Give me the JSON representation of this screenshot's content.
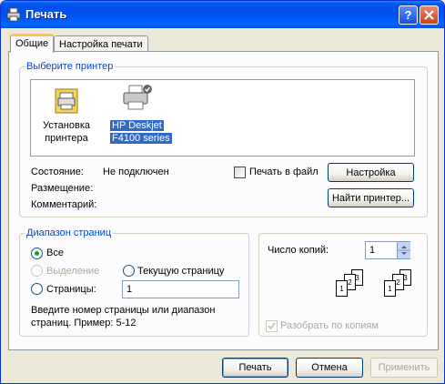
{
  "window": {
    "title": "Печать"
  },
  "tabs": [
    {
      "label": "Общие"
    },
    {
      "label": "Настройка печати"
    }
  ],
  "printer_group": {
    "legend": "Выберите принтер",
    "printers": [
      {
        "label_line1": "Установка",
        "label_line2": "принтера",
        "icon": "add-printer-icon"
      },
      {
        "label_line1": "HP Deskjet",
        "label_line2": "F4100 series",
        "icon": "printer-icon",
        "selected": true
      }
    ],
    "status_label": "Состояние:",
    "status_value": "Не подключен",
    "location_label": "Размещение:",
    "comment_label": "Комментарий:",
    "print_to_file_label": "Печать в файл",
    "preferences_button": "Настройка",
    "find_printer_button": "Найти принтер..."
  },
  "range_group": {
    "legend": "Диапазон страниц",
    "all_label": "Все",
    "selection_label": "Выделение",
    "current_page_label": "Текущую страницу",
    "pages_label": "Страницы:",
    "pages_value": "1",
    "hint_line1": "Введите номер страницы или диапазон",
    "hint_line2": "страниц.  Пример: 5-12"
  },
  "copies_group": {
    "copies_label": "Число копий:",
    "copies_value": "1",
    "collate_label": "Разобрать по копиям",
    "collate_checked": true
  },
  "buttons": {
    "print": "Печать",
    "cancel": "Отмена",
    "apply": "Применить"
  },
  "colors": {
    "titlebar": "#0054e3",
    "face": "#ece9d8",
    "selection": "#316ac5",
    "group_legend": "#0046d5"
  }
}
